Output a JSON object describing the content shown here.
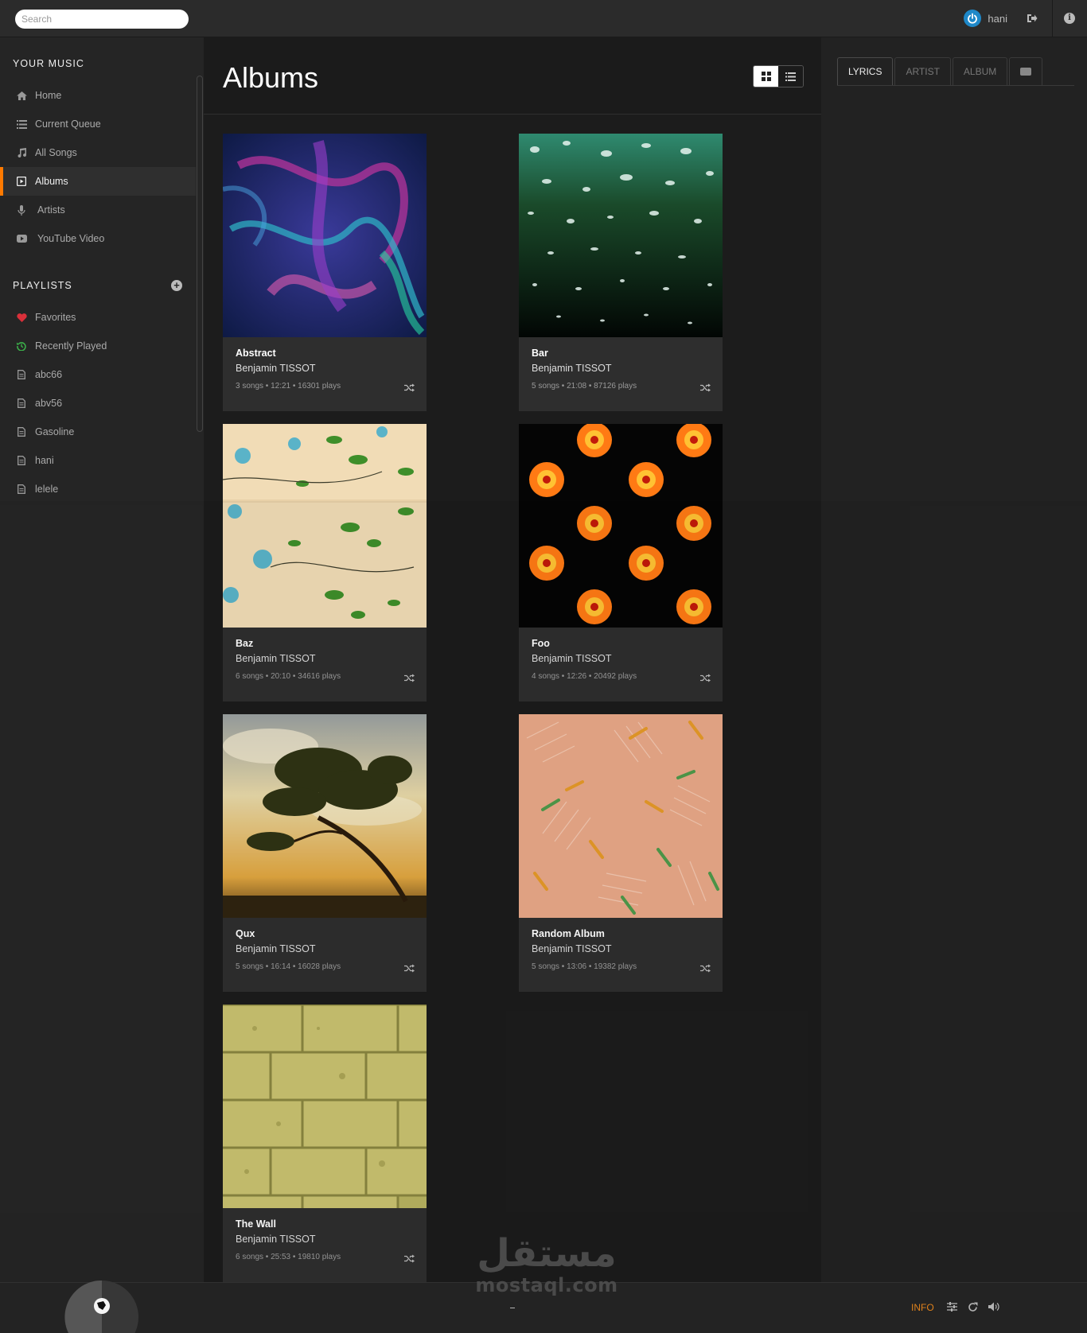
{
  "topbar": {
    "search_placeholder": "Search",
    "username": "hani",
    "icons": [
      "power-icon",
      "logout-icon",
      "info-icon"
    ],
    "accent": "#1e88c8"
  },
  "sidebar": {
    "your_music_title": "YOUR MUSIC",
    "items": [
      {
        "label": "Home",
        "icon": "home-icon"
      },
      {
        "label": "Current Queue",
        "icon": "list-icon"
      },
      {
        "label": "All Songs",
        "icon": "music-note-icon"
      },
      {
        "label": "Albums",
        "icon": "album-icon",
        "active": true
      },
      {
        "label": "Artists",
        "icon": "microphone-icon"
      },
      {
        "label": "YouTube Video",
        "icon": "youtube-icon"
      }
    ],
    "playlists_title": "PLAYLISTS",
    "playlists": [
      {
        "label": "Favorites",
        "icon": "heart-icon",
        "color": "#d9303a"
      },
      {
        "label": "Recently Played",
        "icon": "history-icon",
        "color": "#3cb44b"
      },
      {
        "label": "abc66",
        "icon": "file-icon"
      },
      {
        "label": "abv56",
        "icon": "file-icon"
      },
      {
        "label": "Gasoline",
        "icon": "file-icon"
      },
      {
        "label": "hani",
        "icon": "file-icon"
      },
      {
        "label": "lelele",
        "icon": "file-icon"
      }
    ],
    "active_color": "#ff7a00"
  },
  "main": {
    "title": "Albums",
    "view_modes": [
      "grid-view-icon",
      "list-view-icon"
    ],
    "albums": [
      {
        "name": "Abstract",
        "artist": "Benjamin TISSOT",
        "meta": "3 songs • 12:21 • 16301 plays"
      },
      {
        "name": "Bar",
        "artist": "Benjamin TISSOT",
        "meta": "5 songs • 21:08 • 87126 plays"
      },
      {
        "name": "Baz",
        "artist": "Benjamin TISSOT",
        "meta": "6 songs • 20:10 • 34616 plays"
      },
      {
        "name": "Foo",
        "artist": "Benjamin TISSOT",
        "meta": "4 songs • 12:26 • 20492 plays"
      },
      {
        "name": "Qux",
        "artist": "Benjamin TISSOT",
        "meta": "5 songs • 16:14 • 16028 plays"
      },
      {
        "name": "Random Album",
        "artist": "Benjamin TISSOT",
        "meta": "5 songs • 13:06 • 19382 plays"
      },
      {
        "name": "The Wall",
        "artist": "Benjamin TISSOT",
        "meta": "6 songs • 25:53 • 19810 plays"
      }
    ]
  },
  "right_panel": {
    "tabs": [
      "LYRICS",
      "ARTIST",
      "ALBUM"
    ],
    "active_tab": "LYRICS"
  },
  "footer": {
    "info_label": "INFO",
    "info_color": "#e8871e",
    "icons": [
      "equalizer-icon",
      "repeat-icon",
      "volume-icon"
    ]
  },
  "watermark": {
    "arabic": "مستقل",
    "latin": "mostaql.com"
  }
}
